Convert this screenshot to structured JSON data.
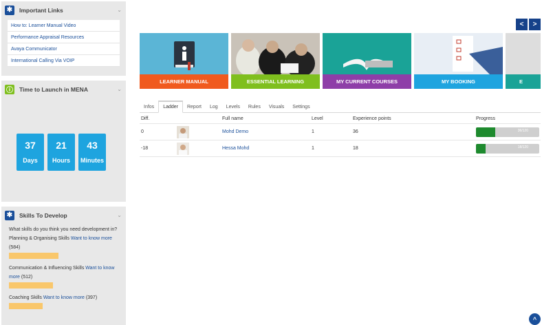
{
  "sidebar": {
    "important_links": {
      "title": "Important Links",
      "links": [
        "How to: Learner Manual Video",
        "Performance Appraisal Resources",
        "Avaya Communicator",
        "International Calling Via VOIP"
      ]
    },
    "time_to_launch": {
      "title": "Time to Launch in MENA",
      "countdown": [
        {
          "value": "37",
          "label": "Days"
        },
        {
          "value": "21",
          "label": "Hours"
        },
        {
          "value": "43",
          "label": "Minutes"
        }
      ]
    },
    "skills": {
      "title": "Skills To Develop",
      "question": "What skills do you think you need development in?",
      "items": [
        {
          "name": "Planning & Organising Skills",
          "link": "Want to know more",
          "count": "(584)",
          "fraction": 0.45
        },
        {
          "name": "Communication & Influencing Skills",
          "link": "Want to know more",
          "count": "(512)",
          "fraction": 0.4
        },
        {
          "name": "Coaching Skills",
          "link": "Want to know more",
          "count": "(397)",
          "fraction": 0.31
        }
      ]
    }
  },
  "nav": {
    "prev": "<",
    "next": ">"
  },
  "tiles": [
    {
      "label": "LEARNER MANUAL",
      "color": "#f05a1e",
      "bg": "#5bb5d6"
    },
    {
      "label": "ESSENTIAL LEARNING",
      "color": "#7fbf1e",
      "bg": "#c9c2b8"
    },
    {
      "label": "MY CURRENT COURSES",
      "color": "#8e3ea8",
      "bg": "#1aa397"
    },
    {
      "label": "MY BOOKING",
      "color": "#1ea4df",
      "bg": "#e8eef5"
    },
    {
      "label": "E",
      "color": "#1aa397",
      "bg": "#dddddd"
    }
  ],
  "tabs": [
    "Infos",
    "Ladder",
    "Report",
    "Log",
    "Levels",
    "Rules",
    "Visuals",
    "Settings"
  ],
  "active_tab": "Ladder",
  "table": {
    "headers": [
      "Diff.",
      "Full name",
      "Level",
      "Experience points",
      "Progress"
    ],
    "rows": [
      {
        "diff": "0",
        "name": "Mohd Demo",
        "level": "1",
        "xp": "36",
        "progress_text": "36/120",
        "progress": 0.3
      },
      {
        "diff": "-18",
        "name": "Hessa Mohd",
        "level": "1",
        "xp": "18",
        "progress_text": "18/120",
        "progress": 0.15
      }
    ]
  },
  "scroll_top": "^"
}
